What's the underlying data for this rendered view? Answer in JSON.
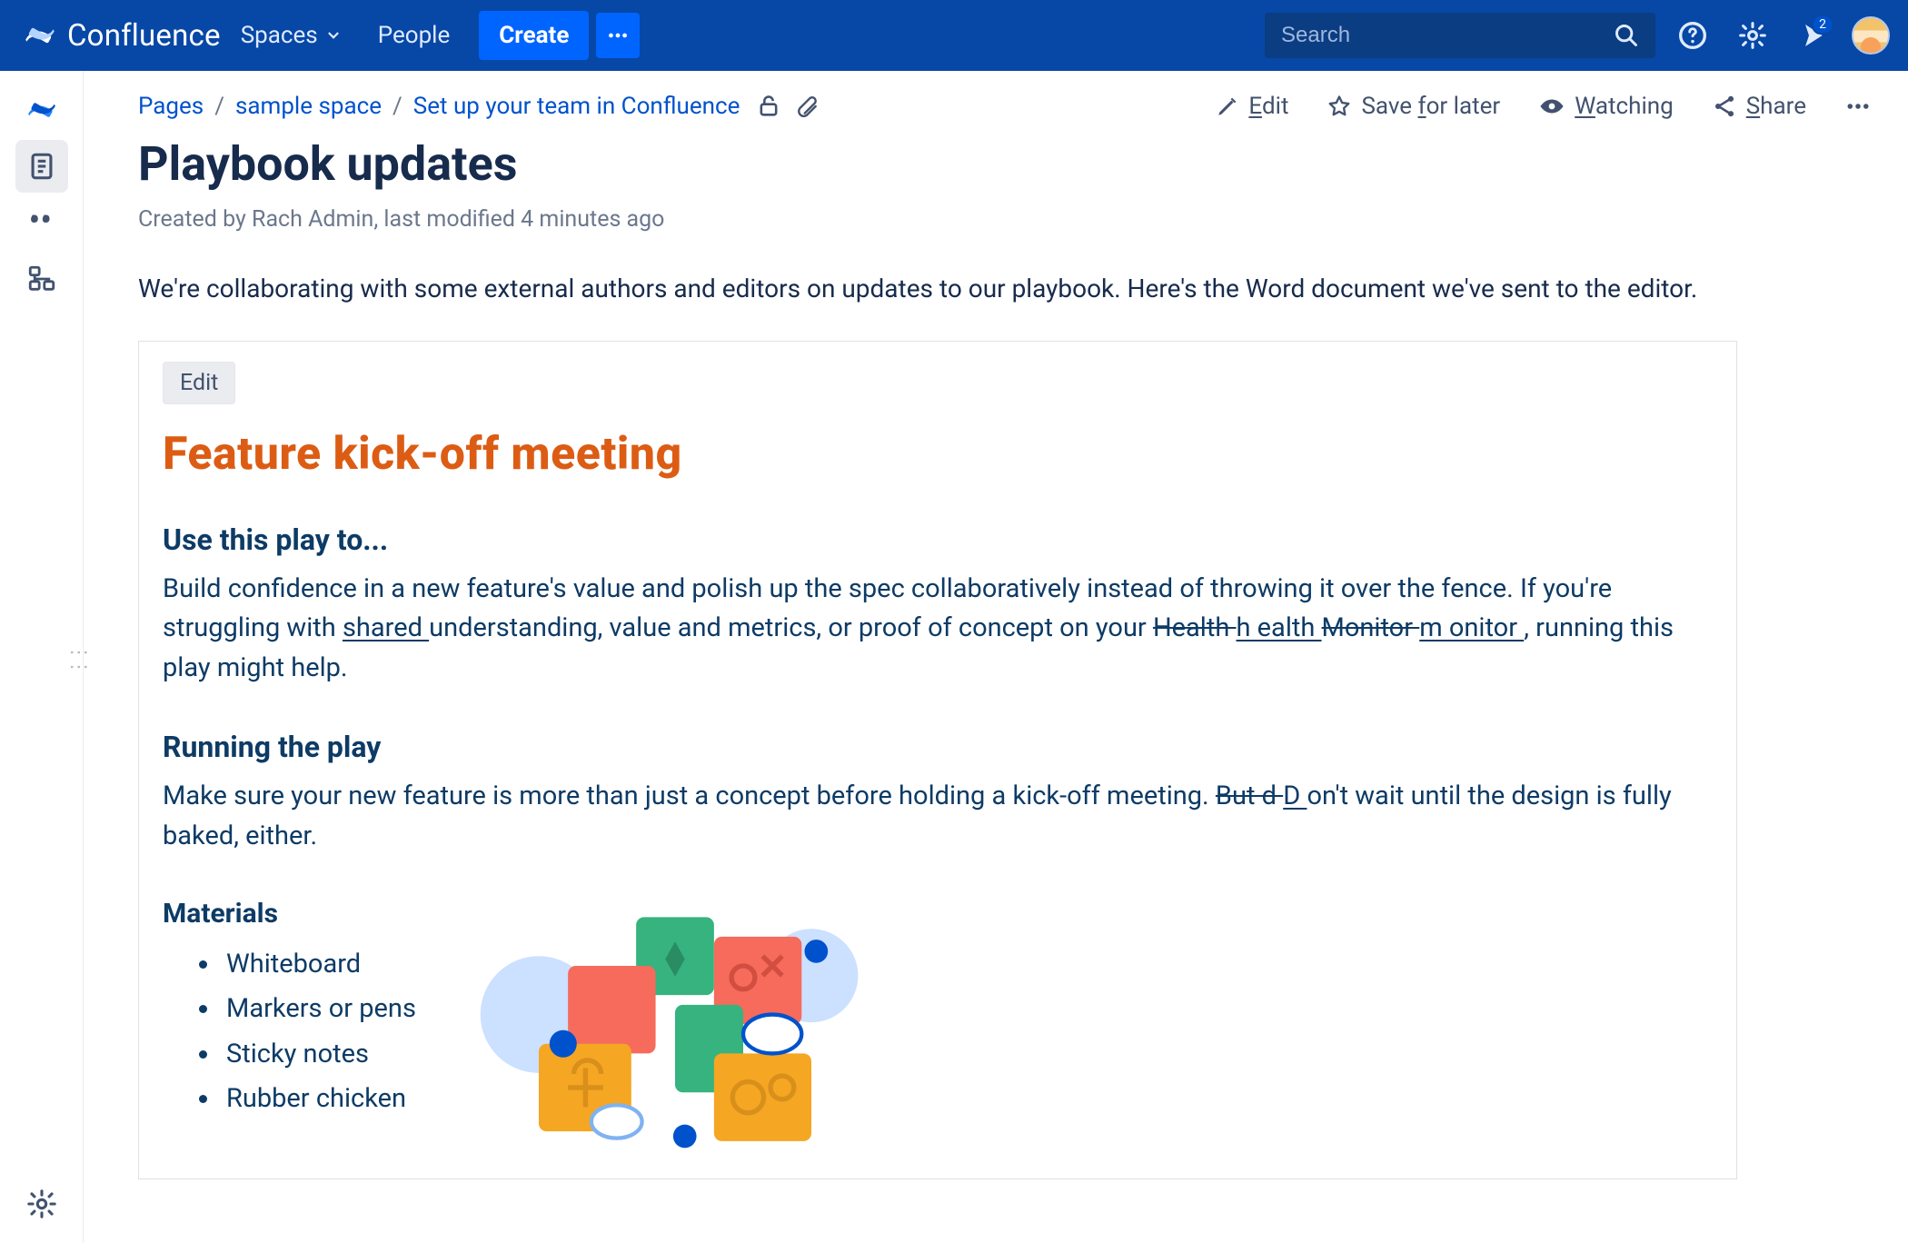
{
  "nav": {
    "brand": "Confluence",
    "spaces": "Spaces",
    "people": "People",
    "create": "Create",
    "search_placeholder": "Search",
    "notif_count": "2"
  },
  "breadcrumbs": {
    "pages": "Pages",
    "space": "sample space",
    "parent": "Set up your team in Confluence"
  },
  "actions": {
    "edit_pre": "E",
    "edit_rest": "dit",
    "save_pre": "Save ",
    "save_u": "f",
    "save_rest": "or later",
    "watch_u": "W",
    "watch_rest": "atching",
    "share_u": "S",
    "share_rest": "hare"
  },
  "page": {
    "title": "Playbook updates",
    "byline": "Created by Rach Admin, last modified 4 minutes ago",
    "intro": "We're collaborating with some external authors and editors on updates to our playbook.  Here's the Word document we've sent to the editor."
  },
  "doc": {
    "edit_label": "Edit",
    "h1": "Feature kick-off meeting",
    "use_h": "Use this play to...",
    "use_p_a": "Build confidence in a new feature's value and polish up the spec collaboratively instead of throwing it over the fence. If you're struggling with ",
    "use_ins1": "shared ",
    "use_p_b": "understanding, value and metrics, or proof of concept on your ",
    "use_del1": "Health ",
    "use_ins2": "h ealth ",
    "use_del2": "Monitor ",
    "use_ins3": "m onitor ",
    "use_p_c": ", running this play might help.",
    "run_h": "Running the play",
    "run_p_a": "Make sure your new feature is more than just a concept before holding a kick-off meeting. ",
    "run_del": "But d ",
    "run_ins": "D ",
    "run_p_b": "on't wait until the design is fully baked, either.",
    "materials_h": "Materials",
    "materials": [
      "Whiteboard",
      "Markers or pens",
      "Sticky notes",
      "Rubber chicken"
    ]
  }
}
